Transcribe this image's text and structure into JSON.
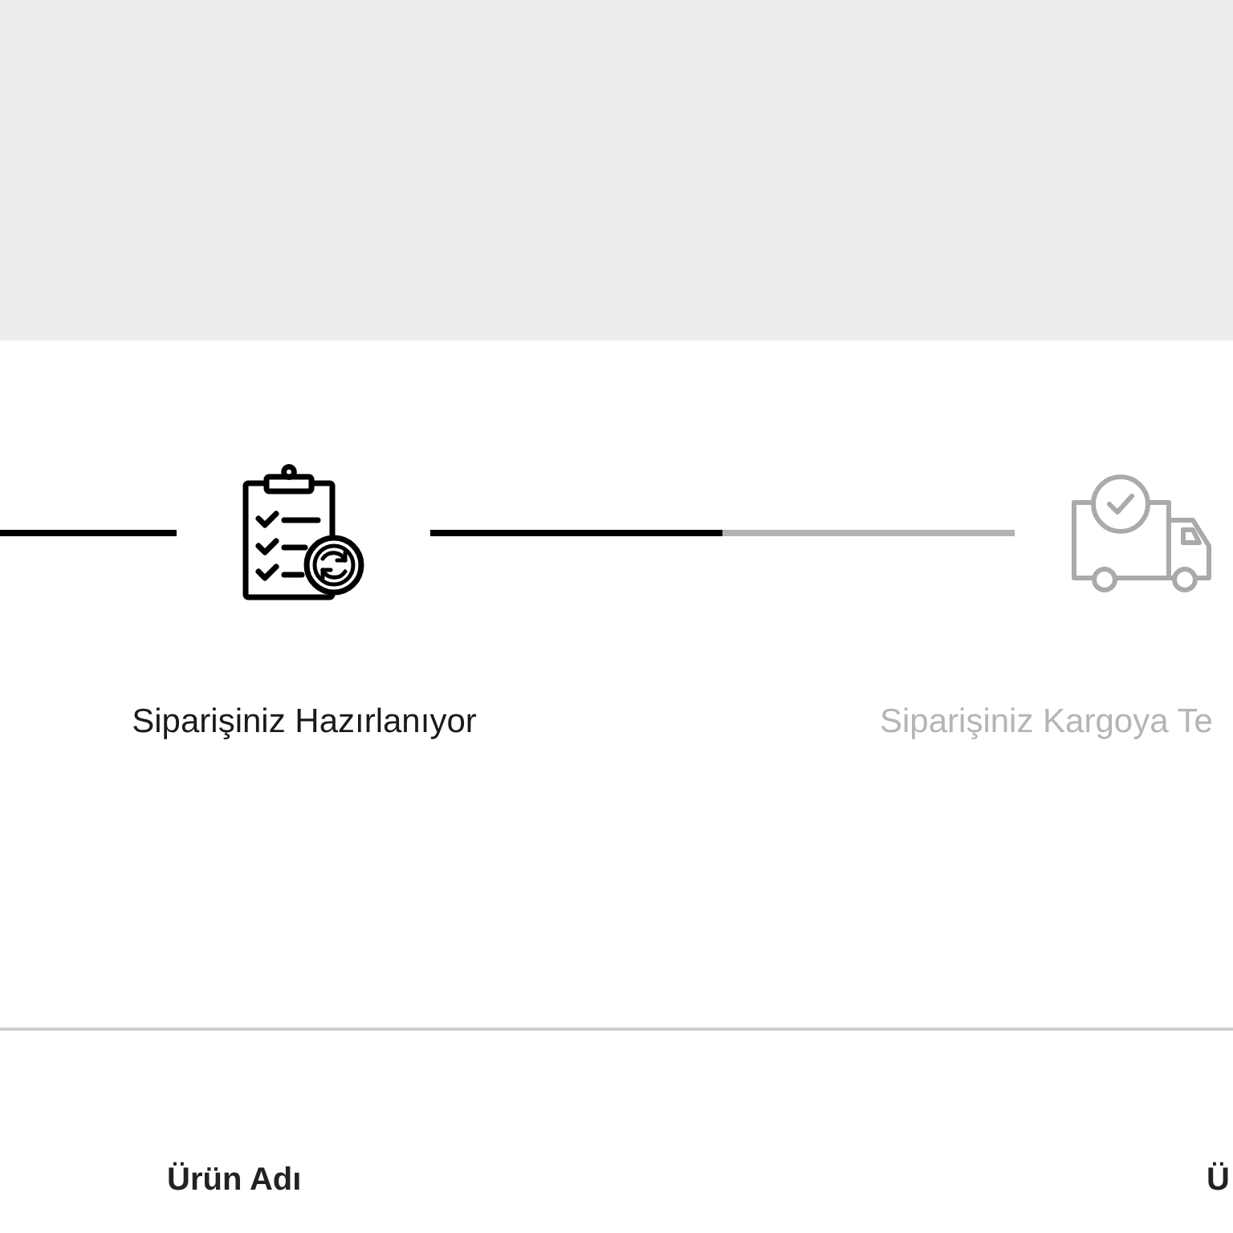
{
  "order_progress": {
    "connectors": [
      {
        "kind": "line",
        "completed": true
      },
      {
        "kind": "bar",
        "level": 0.5
      }
    ],
    "steps": [
      {
        "kind": "preparing",
        "label": "Siparişiniz Hazırlanıyor",
        "active": true
      },
      {
        "kind": "shipping",
        "label": "Siparişiniz Kargoya Te",
        "active": false
      }
    ]
  },
  "product_table": {
    "columns": [
      "Ürün Adı",
      "Ü"
    ]
  }
}
